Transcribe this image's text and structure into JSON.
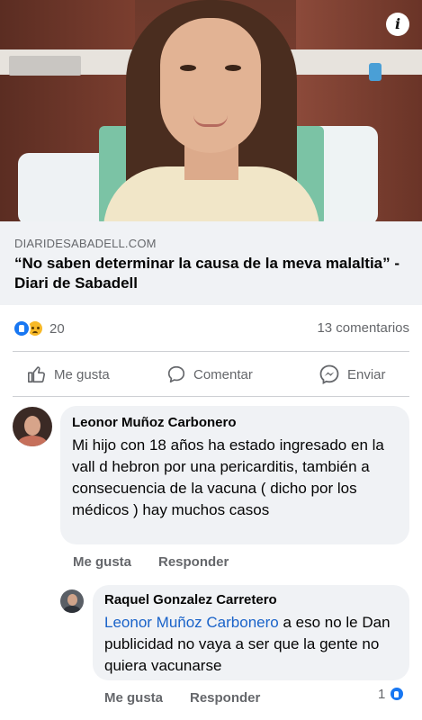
{
  "link_preview": {
    "domain": "DIARIDESABADELL.COM",
    "title": "“No saben determinar la causa de la meva malaltia” - Diari de Sabadell",
    "info_icon": "i"
  },
  "reactions": {
    "count": "20",
    "types": [
      "like-icon",
      "sad-icon"
    ],
    "comments_count": "13 comentarios"
  },
  "actions": {
    "like": "Me gusta",
    "comment": "Comentar",
    "share": "Enviar"
  },
  "comments": [
    {
      "author": "Leonor Muñoz Carbonero",
      "text": "Mi hijo con 18 años  ha estado ingresado en la vall d hebron por una pericarditis, también a consecuencia de la vacuna ( dicho por los médicos ) hay muchos casos",
      "like_label": "Me gusta",
      "reply_label": "Responder"
    },
    {
      "author": "Raquel Gonzalez Carretero",
      "mention": "Leonor Muñoz Carbonero",
      "text": " a eso no le Dan publicidad no vaya a ser que la gente no quiera vacunarse",
      "like_label": "Me gusta",
      "reply_label": "Responder",
      "reaction_count": "1"
    }
  ],
  "colors": {
    "accent": "#1877f2",
    "mention": "#1a63c9",
    "bubble": "#f0f2f5",
    "muted": "#65676b"
  }
}
